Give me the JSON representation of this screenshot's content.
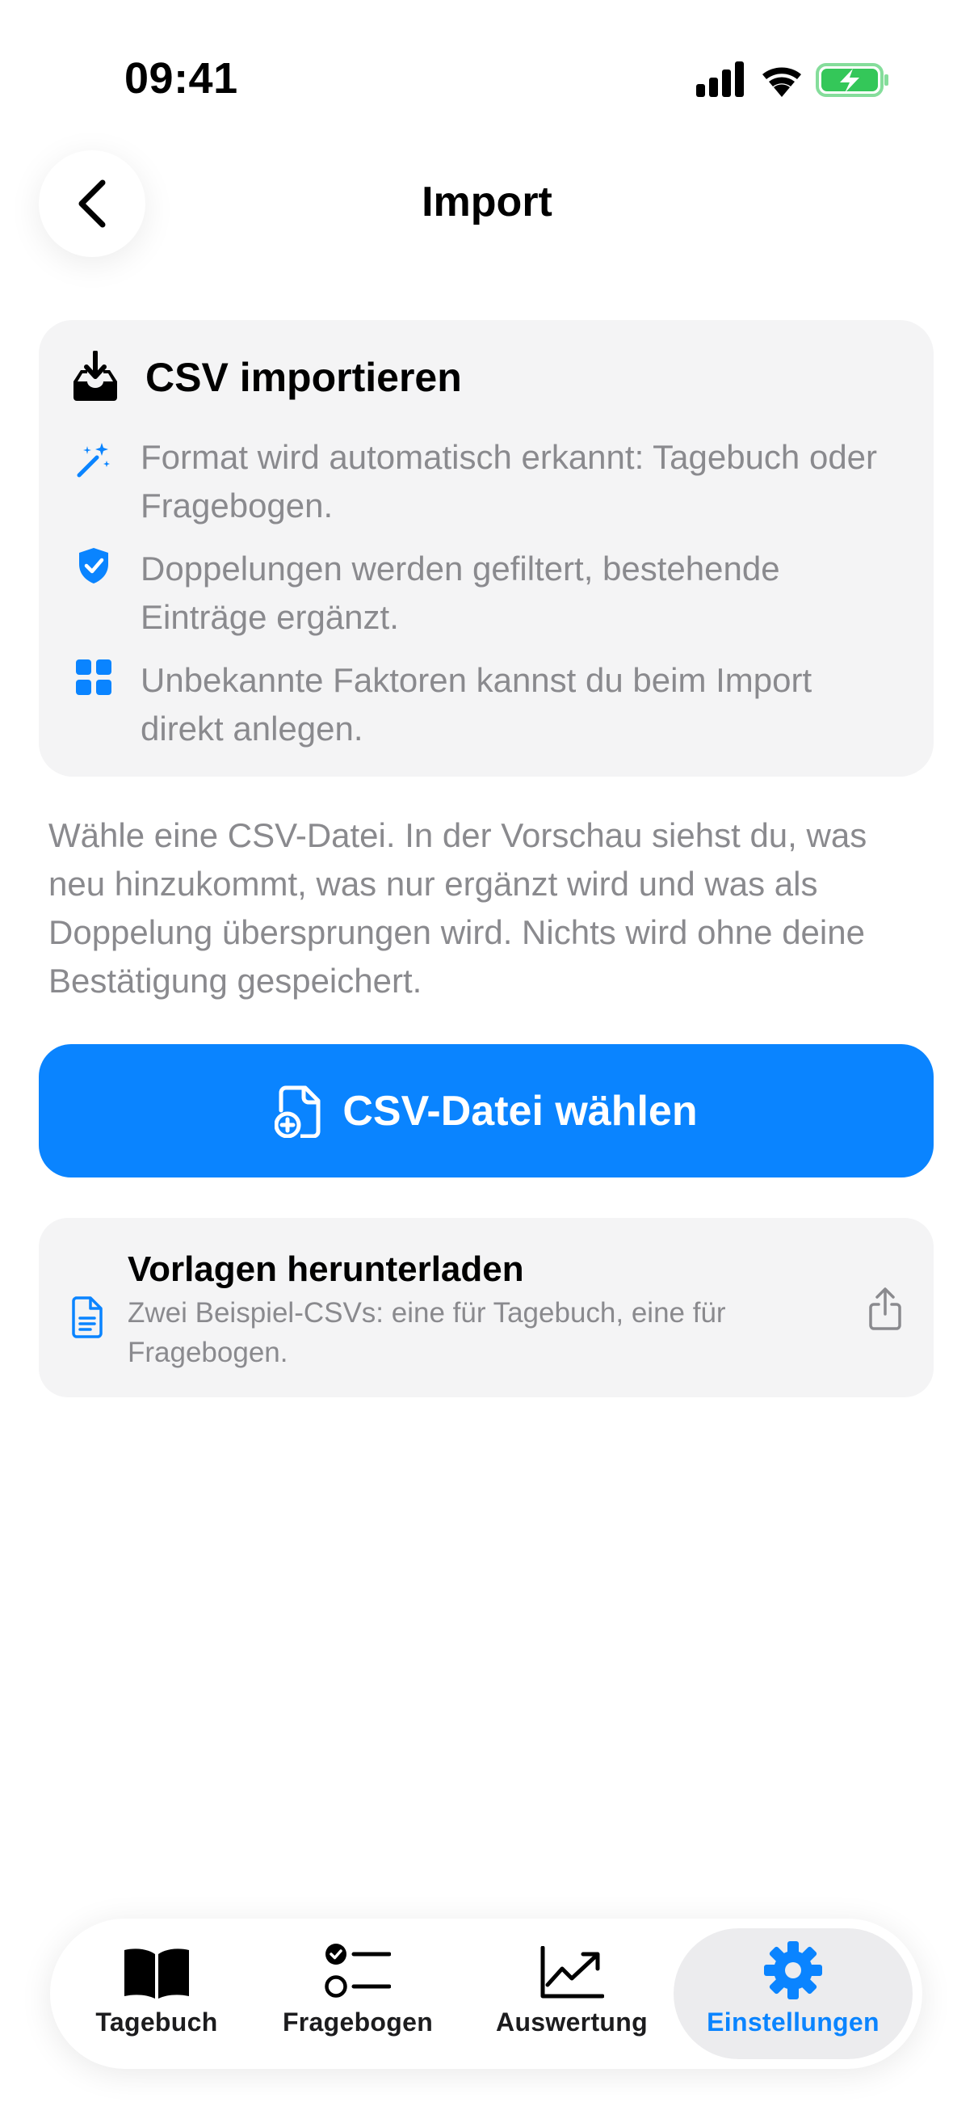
{
  "status_bar": {
    "time": "09:41"
  },
  "header": {
    "title": "Import"
  },
  "info_card": {
    "title": "CSV importieren",
    "features": [
      {
        "icon": "magic-wand-icon",
        "text": "Format wird automatisch erkannt: Tagebuch oder Fragebogen."
      },
      {
        "icon": "shield-check-icon",
        "text": "Doppelungen werden gefiltert, bestehende Einträge ergänzt."
      },
      {
        "icon": "grid-icon",
        "text": "Unbekannte Faktoren kannst du beim Import direkt anlegen."
      }
    ]
  },
  "description": "Wähle eine CSV-Datei. In der Vorschau siehst du, was neu hinzukommt, was nur ergänzt wird und was als Doppelung übersprungen wird. Nichts wird ohne deine Bestätigung gespeichert.",
  "primary_button": {
    "label": "CSV-Datei wählen"
  },
  "template_card": {
    "title": "Vorlagen herunterladen",
    "subtitle": "Zwei Beispiel-CSVs: eine für Tagebuch, eine für Fragebogen."
  },
  "tabbar": {
    "items": [
      {
        "label": "Tagebuch",
        "icon": "book-icon"
      },
      {
        "label": "Fragebogen",
        "icon": "checklist-icon"
      },
      {
        "label": "Auswertung",
        "icon": "chart-up-icon"
      },
      {
        "label": "Einstellungen",
        "icon": "gear-icon"
      }
    ],
    "active_index": 3
  },
  "colors": {
    "accent": "#0a84ff",
    "card_bg": "#f4f4f5",
    "secondary_text": "#8a8a8e"
  }
}
